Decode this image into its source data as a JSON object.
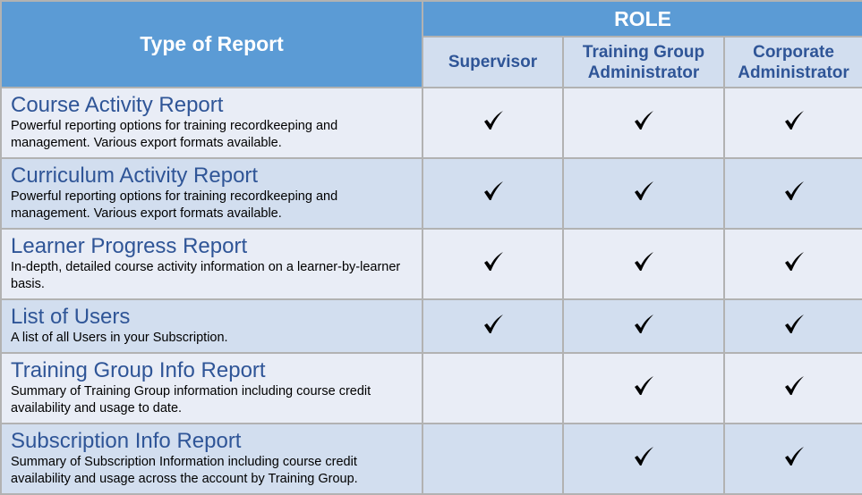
{
  "header": {
    "type_label": "Type of Report",
    "role_label": "ROLE",
    "roles": [
      "Supervisor",
      "Training Group Administrator",
      "Corporate Administrator"
    ]
  },
  "colors": {
    "header_blue": "#5b9bd5",
    "title_blue": "#2f5597",
    "row_light": "#e9edf6",
    "row_dark": "#d2deef"
  },
  "reports": [
    {
      "title": "Course Activity Report",
      "description": "Powerful reporting options for training recordkeeping and management. Various export formats available.",
      "access": {
        "supervisor": "check-icon",
        "training_group_admin": "check-icon",
        "corporate_admin": "check-icon"
      }
    },
    {
      "title": "Curriculum Activity Report",
      "description": "Powerful reporting options for training recordkeeping and management. Various export formats available.",
      "access": {
        "supervisor": "check-icon",
        "training_group_admin": "check-icon",
        "corporate_admin": "check-icon"
      }
    },
    {
      "title": "Learner Progress Report",
      "description": "In-depth, detailed course activity information on a learner-by-learner basis.",
      "access": {
        "supervisor": "check-icon",
        "training_group_admin": "check-icon",
        "corporate_admin": "check-icon"
      }
    },
    {
      "title": "List of Users",
      "description": "A list of all Users in your Subscription.",
      "access": {
        "supervisor": "check-icon",
        "training_group_admin": "check-icon",
        "corporate_admin": "check-icon"
      }
    },
    {
      "title": "Training Group Info Report",
      "description": "Summary of Training Group information including course credit availability and usage to date.",
      "access": {
        "supervisor": "",
        "training_group_admin": "check-icon",
        "corporate_admin": "check-icon"
      }
    },
    {
      "title": "Subscription Info Report",
      "description": "Summary of Subscription Information including course credit availability and usage across the account by Training Group.",
      "access": {
        "supervisor": "",
        "training_group_admin": "check-icon",
        "corporate_admin": "check-icon"
      }
    }
  ]
}
